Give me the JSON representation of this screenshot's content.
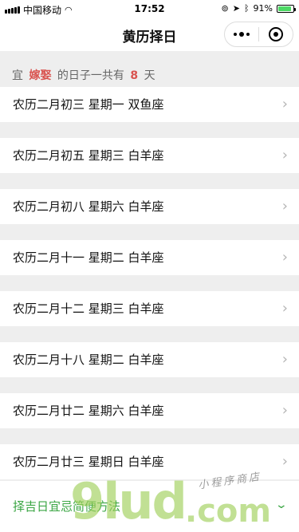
{
  "status_bar": {
    "carrier": "中国移动",
    "time": "17:52",
    "battery_percent": "91%",
    "battery_level": 0.91,
    "battery_color": "#4cd964"
  },
  "nav": {
    "title": "黄历择日",
    "menu_icon": "more-dots-icon",
    "close_icon": "target-circle-icon"
  },
  "summary": {
    "prefix": "宜",
    "event": "嫁娶",
    "middle": "的日子一共有",
    "count": "8",
    "suffix": "天",
    "highlight_color": "#d9534f"
  },
  "days": [
    {
      "text": "农历二月初三  星期一  双鱼座"
    },
    {
      "text": "农历二月初五  星期三  白羊座"
    },
    {
      "text": "农历二月初八  星期六  白羊座"
    },
    {
      "text": "农历二月十一  星期二  白羊座"
    },
    {
      "text": "农历二月十二  星期三  白羊座"
    },
    {
      "text": "农历二月十八  星期二  白羊座"
    },
    {
      "text": "农历二月廿二  星期六  白羊座"
    },
    {
      "text": "农历二月廿三  星期日  白羊座"
    }
  ],
  "footer": {
    "label": "择吉日宜忌简便方法",
    "accent_color": "#3aa543"
  },
  "watermark": {
    "big": "9lud",
    "dot": ".com",
    "small": "小程序商店"
  }
}
